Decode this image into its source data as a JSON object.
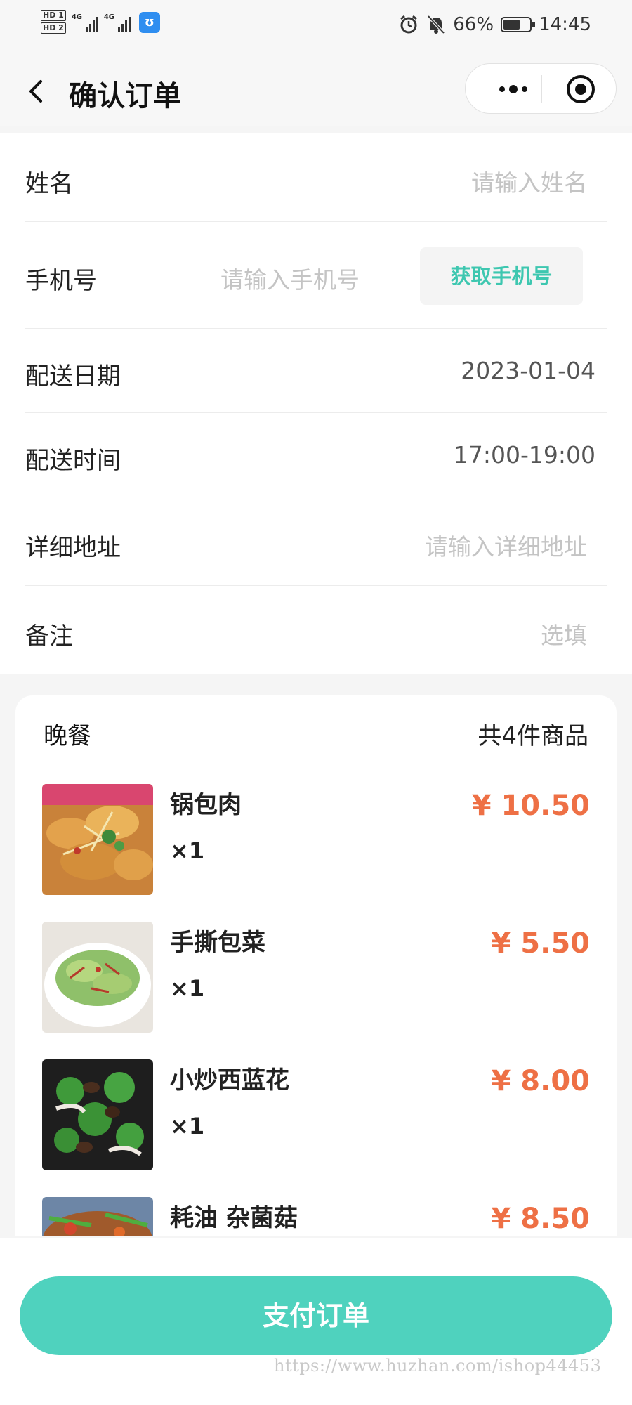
{
  "status_bar": {
    "hd1": "HD 1",
    "hd2": "HD 2",
    "net1": "4G",
    "net2": "4G",
    "battery_percent": "66%",
    "battery_level": 0.66,
    "time": "14:45",
    "icons": [
      "alarm-icon",
      "bell-off-icon",
      "battery-icon"
    ]
  },
  "nav": {
    "title": "确认订单",
    "back_icon": "chevron-left-icon",
    "more_icon": "more-dots-icon",
    "close_icon": "target-icon"
  },
  "form": {
    "name": {
      "label": "姓名",
      "placeholder": "请输入姓名"
    },
    "phone": {
      "label": "手机号",
      "placeholder": "请输入手机号",
      "button": "获取手机号"
    },
    "date": {
      "label": "配送日期",
      "value": "2023-01-04"
    },
    "time": {
      "label": "配送时间",
      "value": "17:00-19:00"
    },
    "address": {
      "label": "详细地址",
      "placeholder": "请输入详细地址"
    },
    "remark": {
      "label": "备注",
      "placeholder": "选填"
    }
  },
  "goods": {
    "meal": "晚餐",
    "count_text": "共4件商品",
    "items": [
      {
        "name": "锅包肉",
        "qty": "×1",
        "price": "¥ 10.50"
      },
      {
        "name": "手撕包菜",
        "qty": "×1",
        "price": "¥ 5.50"
      },
      {
        "name": "小炒西蓝花",
        "qty": "×1",
        "price": "¥ 8.00"
      },
      {
        "name": "耗油 杂菌菇",
        "qty": "",
        "price": "¥ 8.50"
      }
    ]
  },
  "footer": {
    "pay_button": "支付订单",
    "watermark": "https://www.huzhan.com/ishop44453"
  },
  "colors": {
    "accent": "#4fd2be",
    "price": "#ee7045",
    "placeholder": "#c4c4c4"
  }
}
